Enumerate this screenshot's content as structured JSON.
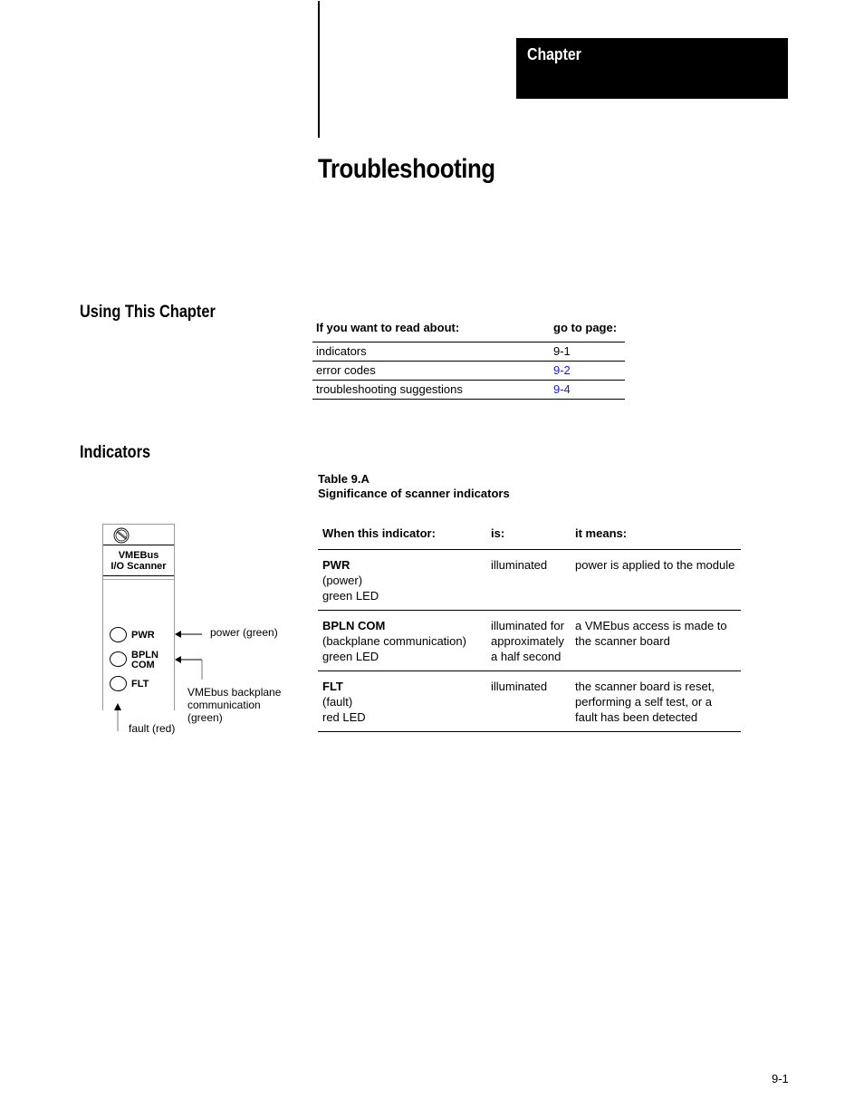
{
  "header": {
    "chapter_label": "Chapter",
    "title": "Troubleshooting"
  },
  "using_chapter": {
    "heading": "Using This Chapter",
    "table": {
      "columns": [
        "If you want to read about:",
        "go to page:"
      ],
      "rows": [
        {
          "topic": "indicators",
          "page": "9-1",
          "linked": false
        },
        {
          "topic": "error codes",
          "page": "9-2",
          "linked": true
        },
        {
          "topic": "troubleshooting suggestions",
          "page": "9-4",
          "linked": true
        }
      ]
    }
  },
  "indicators": {
    "heading": "Indicators",
    "caption_number": "Table 9.A",
    "caption_title": "Significance of scanner indicators",
    "table": {
      "columns": [
        "When this indicator:",
        "is:",
        "it means:"
      ],
      "rows": [
        {
          "indicator": "PWR",
          "desc": "(power)",
          "led": "green LED",
          "state": "illuminated",
          "meaning": "power is applied to the module"
        },
        {
          "indicator": "BPLN COM",
          "desc": "(backplane communication)",
          "led": "green LED",
          "state": "illuminated for approximately a half second",
          "meaning": "a VMEbus access is made to the scanner board"
        },
        {
          "indicator": "FLT",
          "desc": "(fault)",
          "led": "red LED",
          "state": "illuminated",
          "meaning": "the scanner board is reset, performing a self test, or a fault has been detected"
        }
      ]
    },
    "diagram": {
      "module_name_line1": "VMEBus",
      "module_name_line2": "I/O Scanner",
      "leds": [
        {
          "label1": "PWR",
          "label2": ""
        },
        {
          "label1": "BPLN",
          "label2": "COM"
        },
        {
          "label1": "FLT",
          "label2": ""
        }
      ],
      "annotations": {
        "power": "power (green)",
        "backplane_line1": "VMEbus backplane",
        "backplane_line2": "communication",
        "backplane_line3": "(green)",
        "fault": "fault (red)"
      }
    }
  },
  "footer": {
    "page_number": "9-1"
  }
}
